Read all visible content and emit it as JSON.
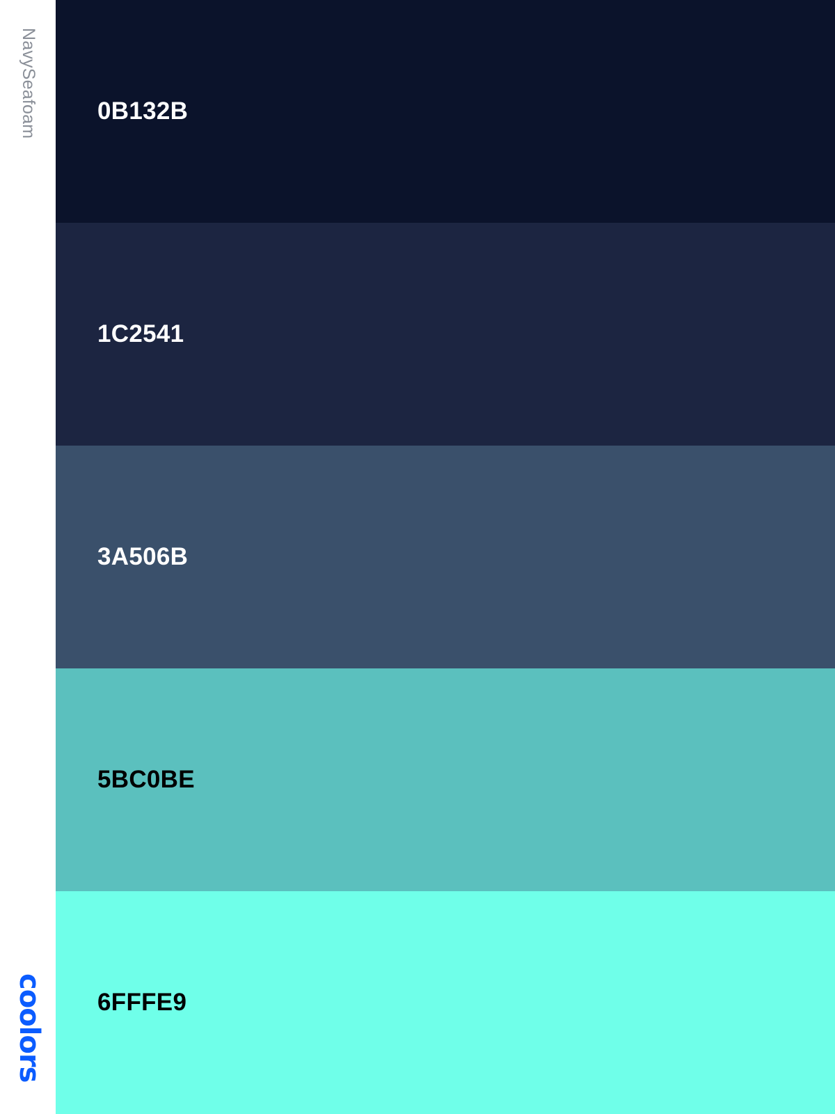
{
  "palette": {
    "name": "NavySeafoam"
  },
  "brand": {
    "logo_text": "coolors",
    "color": "#0B5CFF"
  },
  "swatches": [
    {
      "hex_label": "0B132B",
      "color": "#0B132B",
      "text_color": "#FFFFFF"
    },
    {
      "hex_label": "1C2541",
      "color": "#1C2541",
      "text_color": "#FFFFFF"
    },
    {
      "hex_label": "3A506B",
      "color": "#3A506B",
      "text_color": "#FFFFFF"
    },
    {
      "hex_label": "5BC0BE",
      "color": "#5BC0BE",
      "text_color": "#000000"
    },
    {
      "hex_label": "6FFFE9",
      "color": "#6FFFE9",
      "text_color": "#000000"
    }
  ]
}
